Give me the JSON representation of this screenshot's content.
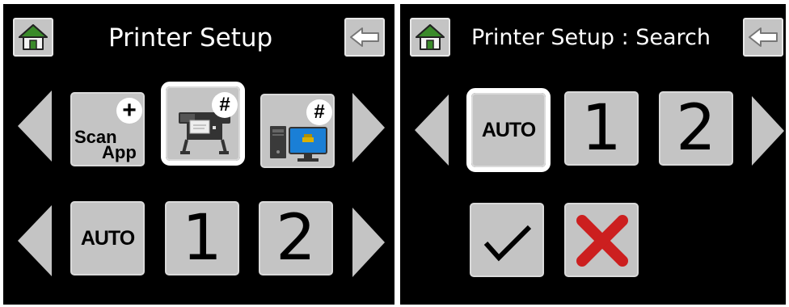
{
  "left_screen": {
    "title": "Printer Setup",
    "icons": {
      "home": "home-icon",
      "back": "back-arrow-icon",
      "prev": "triangle-left-icon",
      "next": "triangle-right-icon"
    },
    "row1": {
      "scan_app": {
        "line1": "Scan",
        "line2": "App",
        "badge": "+"
      },
      "large_printer": {
        "badge": "#"
      },
      "computer_link": {
        "badge": "#"
      }
    },
    "row2": {
      "auto": "AUTO",
      "one": "1",
      "two": "2"
    }
  },
  "right_screen": {
    "title": "Printer Setup : Search",
    "icons": {
      "home": "home-icon",
      "back": "back-arrow-icon",
      "confirm": "checkmark-icon",
      "cancel": "x-mark-icon"
    },
    "row1": {
      "auto": "AUTO",
      "one": "1",
      "two": "2"
    }
  },
  "colors": {
    "screen_bg": "#000000",
    "tile": "#c4c4c4",
    "house_green": "#3a8a2a",
    "cancel_red": "#cc1f1f",
    "highlight": "#ffffff"
  }
}
